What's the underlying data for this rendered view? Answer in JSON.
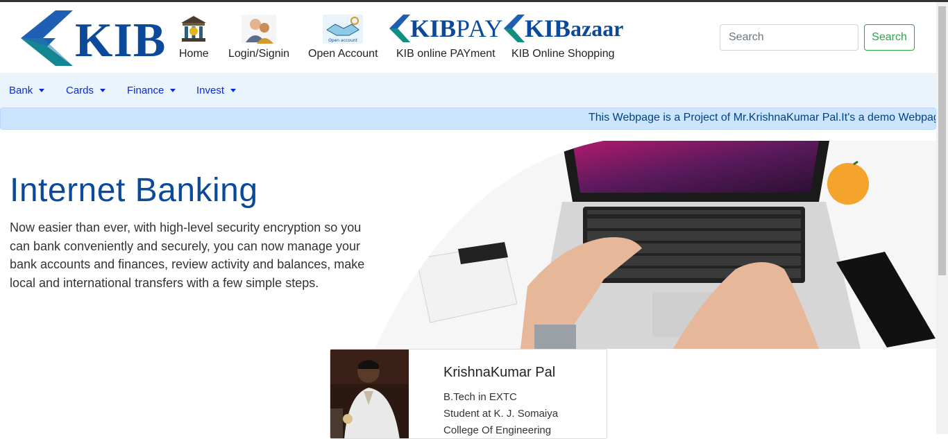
{
  "header": {
    "logo_text": "KIB",
    "nav": [
      {
        "label": "Home",
        "icon": "bank-building-icon"
      },
      {
        "label": "Login/Signin",
        "icon": "users-icon"
      },
      {
        "label": "Open Account",
        "icon": "handshake-icon",
        "icon_caption": "Open account"
      },
      {
        "label": "KIB online PAYment",
        "icon": "kibpay-logo",
        "wordmark_a": "KIB",
        "wordmark_b": "PAY"
      },
      {
        "label": "KIB Online Shopping",
        "icon": "kibazaar-logo",
        "wordmark_a": "KIB",
        "wordmark_b": "azaar"
      }
    ],
    "search": {
      "placeholder": "Search",
      "button_label": "Search"
    }
  },
  "menubar": {
    "items": [
      {
        "label": "Bank"
      },
      {
        "label": "Cards"
      },
      {
        "label": "Finance"
      },
      {
        "label": "Invest"
      }
    ]
  },
  "marquee": {
    "text": "This Webpage is a Project of Mr.KrishnaKumar Pal.It's a demo Webpage"
  },
  "hero": {
    "title": "Internet Banking",
    "description": "Now easier than ever, with high-level security encryption so you can bank conveniently and securely, you can now manage your bank accounts and finances, review activity and balances, make local and international transfers with a few simple steps."
  },
  "profile_card": {
    "name": "KrishnaKumar Pal",
    "lines": [
      "B.Tech in EXTC",
      "Student at K. J. Somaiya",
      "College Of Engineering"
    ]
  },
  "colors": {
    "brand_blue": "#0b4a9a",
    "menu_link": "#0a2ad6",
    "success_green": "#28a745",
    "menubar_bg": "#eaf4fd",
    "alert_bg": "#cce5ff"
  }
}
